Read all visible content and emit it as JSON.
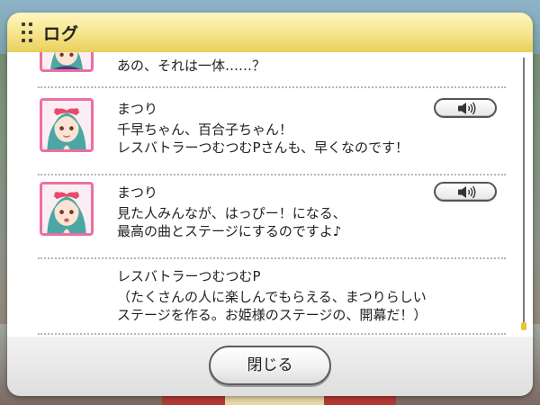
{
  "dialog": {
    "title": "ログ",
    "close_label": "閉じる"
  },
  "log": [
    {
      "type": "partial",
      "text": "あの、それは一体……？"
    },
    {
      "type": "dialogue",
      "speaker": "まつり",
      "text": "千早ちゃん、百合子ちゃん！\nレスバトラーつむつむPさんも、早くなのです！",
      "has_voice": true
    },
    {
      "type": "dialogue",
      "speaker": "まつり",
      "text": "見た人みんなが、はっぴー！になる、\n最高の曲とステージにするのですよ♪",
      "has_voice": true
    },
    {
      "type": "narration",
      "speaker": "レスバトラーつむつむP",
      "text": "（たくさんの人に楽しんでもらえる、まつりらしい\nステージを作る。お姫様のステージの、開幕だ！）"
    }
  ],
  "icons": {
    "grip": "grip-icon",
    "voice": "speaker-icon"
  },
  "colors": {
    "header": "#f6e48a",
    "avatar_border": "#ec6fa4",
    "scroll_thumb": "#e9c53a"
  }
}
